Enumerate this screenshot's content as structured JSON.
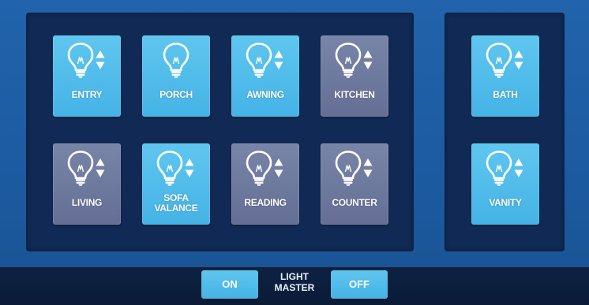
{
  "lights": {
    "entry": {
      "label": "ENTRY",
      "state": "on",
      "dimmable": true
    },
    "porch": {
      "label": "PORCH",
      "state": "on",
      "dimmable": false
    },
    "awning": {
      "label": "AWNING",
      "state": "on",
      "dimmable": true
    },
    "kitchen": {
      "label": "KITCHEN",
      "state": "off",
      "dimmable": true
    },
    "living": {
      "label": "LIVING",
      "state": "off",
      "dimmable": true
    },
    "sofa_valance": {
      "label_line1": "SOFA",
      "label_line2": "VALANCE",
      "state": "on",
      "dimmable": true
    },
    "reading": {
      "label": "READING",
      "state": "off",
      "dimmable": true
    },
    "counter": {
      "label": "COUNTER",
      "state": "off",
      "dimmable": true
    },
    "bath": {
      "label": "BATH",
      "state": "on",
      "dimmable": true
    },
    "vanity": {
      "label": "VANITY",
      "state": "on",
      "dimmable": true
    }
  },
  "master": {
    "on_label": "ON",
    "title_line1": "LIGHT",
    "title_line2": "MASTER",
    "off_label": "OFF"
  },
  "icons": {
    "bulb": "light-bulb-icon",
    "dimmer": "up-down-arrows-icon"
  },
  "colors": {
    "background": "#1c5aa0",
    "panel": "#102a55",
    "button_on": "#4fbbea",
    "button_off": "#6c779c",
    "bottom_bar": "#0c1f3d"
  }
}
